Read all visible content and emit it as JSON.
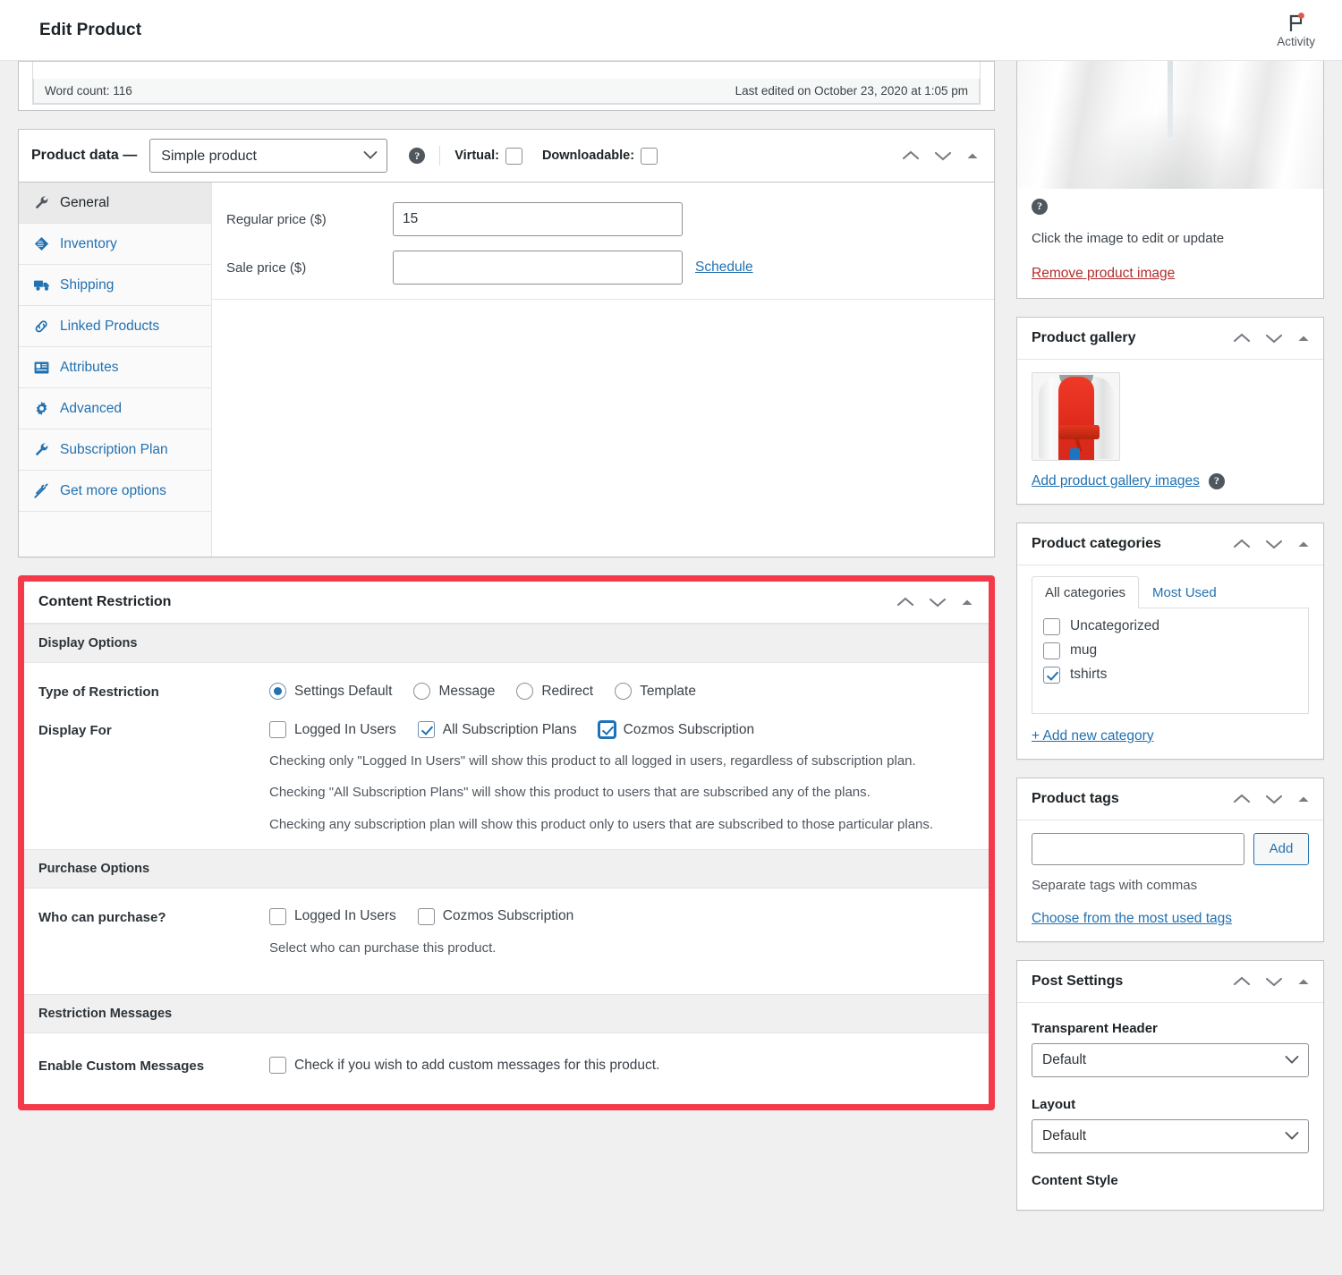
{
  "topbar": {
    "title": "Edit Product",
    "activity_label": "Activity",
    "flag_icon": "flag-icon",
    "notification_dot_color": "#e2574c"
  },
  "editor": {
    "word_count": "Word count: 116",
    "last_edited": "Last edited on October 23, 2020 at 1:05 pm"
  },
  "product_data": {
    "title": "Product data —",
    "type_selected": "Simple product",
    "type_options": [
      "Simple product"
    ],
    "help_icon": "help-icon",
    "virtual_label": "Virtual:",
    "virtual_checked": false,
    "downloadable_label": "Downloadable:",
    "downloadable_checked": false,
    "tabs": [
      {
        "label": "General",
        "icon": "wrench-icon",
        "active": true
      },
      {
        "label": "Inventory",
        "icon": "tag-icon",
        "active": false
      },
      {
        "label": "Shipping",
        "icon": "truck-icon",
        "active": false
      },
      {
        "label": "Linked Products",
        "icon": "link-icon",
        "active": false
      },
      {
        "label": "Attributes",
        "icon": "id-card-icon",
        "active": false
      },
      {
        "label": "Advanced",
        "icon": "gear-icon",
        "active": false
      },
      {
        "label": "Subscription Plan",
        "icon": "wrench-icon",
        "active": false
      },
      {
        "label": "Get more options",
        "icon": "plug-icon",
        "active": false
      }
    ],
    "regular_price_label": "Regular price ($)",
    "regular_price_value": "15",
    "sale_price_label": "Sale price ($)",
    "sale_price_value": "",
    "schedule_label": "Schedule"
  },
  "content_restriction": {
    "title": "Content Restriction",
    "highlight_color": "#f3394a",
    "sections": {
      "display_options": "Display Options",
      "purchase_options": "Purchase Options",
      "restriction_messages": "Restriction Messages"
    },
    "type_of_restriction": {
      "label": "Type of Restriction",
      "options": [
        {
          "label": "Settings Default",
          "selected": true
        },
        {
          "label": "Message",
          "selected": false
        },
        {
          "label": "Redirect",
          "selected": false
        },
        {
          "label": "Template",
          "selected": false
        }
      ]
    },
    "display_for": {
      "label": "Display For",
      "options": [
        {
          "label": "Logged In Users",
          "checked": false,
          "focused": false
        },
        {
          "label": "All Subscription Plans",
          "checked": true,
          "focused": false
        },
        {
          "label": "Cozmos Subscription",
          "checked": true,
          "focused": true
        }
      ],
      "descriptions": [
        "Checking only \"Logged In Users\" will show this product to all logged in users, regardless of subscription plan.",
        "Checking \"All Subscription Plans\" will show this product to users that are subscribed any of the plans.",
        "Checking any subscription plan will show this product only to users that are subscribed to those particular plans."
      ]
    },
    "who_can_purchase": {
      "label": "Who can purchase?",
      "options": [
        {
          "label": "Logged In Users",
          "checked": false
        },
        {
          "label": "Cozmos Subscription",
          "checked": false
        }
      ],
      "description": "Select who can purchase this product."
    },
    "enable_custom_messages": {
      "label": "Enable Custom Messages",
      "checkbox_label": "Check if you wish to add custom messages for this product.",
      "checked": false
    }
  },
  "featured_image": {
    "help_icon": "help-icon",
    "caption": "Click the image to edit or update",
    "remove_label": "Remove product image"
  },
  "product_gallery": {
    "title": "Product gallery",
    "add_link": "Add product gallery images",
    "help_icon": "help-icon"
  },
  "product_categories": {
    "title": "Product categories",
    "tabs": [
      {
        "label": "All categories",
        "active": true
      },
      {
        "label": "Most Used",
        "active": false
      }
    ],
    "items": [
      {
        "label": "Uncategorized",
        "checked": false
      },
      {
        "label": "mug",
        "checked": false
      },
      {
        "label": "tshirts",
        "checked": true
      }
    ],
    "add_new": "+ Add new category"
  },
  "product_tags": {
    "title": "Product tags",
    "input_value": "",
    "input_placeholder": "",
    "add_button": "Add",
    "hint": "Separate tags with commas",
    "choose_link": "Choose from the most used tags"
  },
  "post_settings": {
    "title": "Post Settings",
    "fields": [
      {
        "label": "Transparent Header",
        "value": "Default"
      },
      {
        "label": "Layout",
        "value": "Default"
      }
    ],
    "trailing_label": "Content Style"
  },
  "panel_controls": {
    "move_up_icon": "chevron-up-icon",
    "move_down_icon": "chevron-down-icon",
    "toggle_icon": "triangle-up-icon"
  }
}
